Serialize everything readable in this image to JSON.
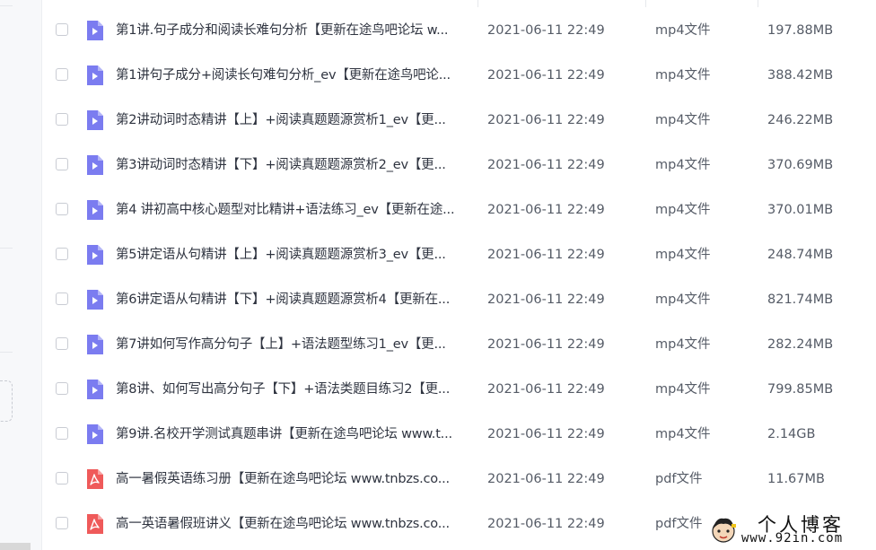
{
  "files": [
    {
      "name": "第1讲.句子成分和阅读长难句分析【更新在途鸟吧论坛 w...",
      "date": "2021-06-11 22:49",
      "type": "mp4文件",
      "size": "197.88MB",
      "icon": "video-file-icon"
    },
    {
      "name": "第1讲句子成分+阅读长句难句分析_ev【更新在途鸟吧论...",
      "date": "2021-06-11 22:49",
      "type": "mp4文件",
      "size": "388.42MB",
      "icon": "video-file-icon"
    },
    {
      "name": "第2讲动词时态精讲【上】+阅读真题题源赏析1_ev【更...",
      "date": "2021-06-11 22:49",
      "type": "mp4文件",
      "size": "246.22MB",
      "icon": "video-file-icon"
    },
    {
      "name": "第3讲动词时态精讲【下】+阅读真题题源赏析2_ev【更...",
      "date": "2021-06-11 22:49",
      "type": "mp4文件",
      "size": "370.69MB",
      "icon": "video-file-icon"
    },
    {
      "name": "第4 讲初高中核心题型对比精讲+语法练习_ev【更新在途...",
      "date": "2021-06-11 22:49",
      "type": "mp4文件",
      "size": "370.01MB",
      "icon": "video-file-icon"
    },
    {
      "name": "第5讲定语从句精讲【上】+阅读真题题源赏析3_ev【更...",
      "date": "2021-06-11 22:49",
      "type": "mp4文件",
      "size": "248.74MB",
      "icon": "video-file-icon"
    },
    {
      "name": "第6讲定语从句精讲【下】+阅读真题题源赏析4【更新在...",
      "date": "2021-06-11 22:49",
      "type": "mp4文件",
      "size": "821.74MB",
      "icon": "video-file-icon"
    },
    {
      "name": "第7讲如何写作高分句子【上】+语法题型练习1_ev【更...",
      "date": "2021-06-11 22:49",
      "type": "mp4文件",
      "size": "282.24MB",
      "icon": "video-file-icon"
    },
    {
      "name": "第8讲、如何写出高分句子【下】+语法类题目练习2【更...",
      "date": "2021-06-11 22:49",
      "type": "mp4文件",
      "size": "799.85MB",
      "icon": "video-file-icon"
    },
    {
      "name": "第9讲.名校开学测试真题串讲【更新在途鸟吧论坛 www.t...",
      "date": "2021-06-11 22:49",
      "type": "mp4文件",
      "size": "2.14GB",
      "icon": "video-file-icon"
    },
    {
      "name": "高一暑假英语练习册【更新在途鸟吧论坛 www.tnbzs.co...",
      "date": "2021-06-11 22:49",
      "type": "pdf文件",
      "size": "11.67MB",
      "icon": "pdf-file-icon"
    },
    {
      "name": "高一英语暑假班讲义【更新在途鸟吧论坛 www.tnbzs.co...",
      "date": "2021-06-11 22:49",
      "type": "pdf文件",
      "size": "",
      "icon": "pdf-file-icon"
    }
  ],
  "watermark": {
    "title": "个人博客",
    "url": "www.92in.com"
  },
  "colors": {
    "video_icon": "#7b7cf0",
    "pdf_icon": "#ef5a5a",
    "text": "#2f3440",
    "muted": "#555b66"
  }
}
